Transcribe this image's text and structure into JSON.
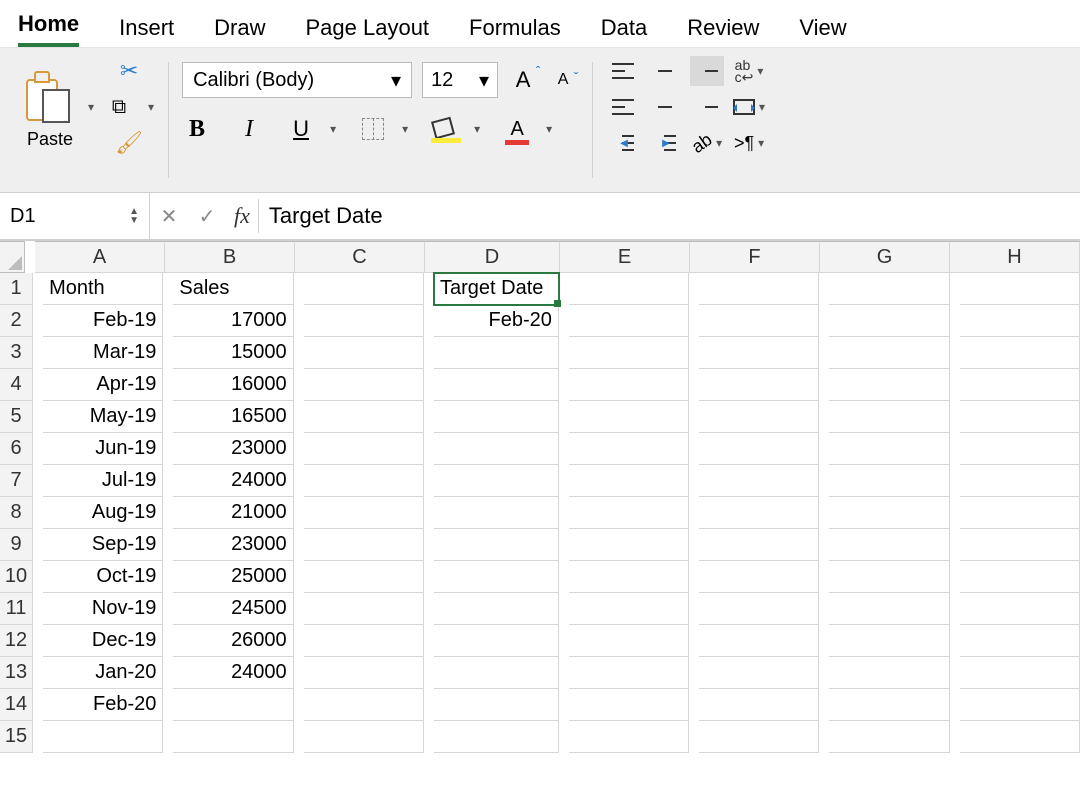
{
  "tabs": [
    "Home",
    "Insert",
    "Draw",
    "Page Layout",
    "Formulas",
    "Data",
    "Review",
    "View"
  ],
  "active_tab": "Home",
  "clipboard": {
    "paste_label": "Paste"
  },
  "font": {
    "name": "Calibri (Body)",
    "size": "12",
    "bold": "B",
    "italic": "I",
    "underline": "U",
    "grow": "A",
    "shrink": "A",
    "fontcolor_letter": "A"
  },
  "alignment": {
    "wrap_label": "ab\nc↩",
    "rotate_label": "ab",
    "para_label": ">¶"
  },
  "formula_bar": {
    "name_box": "D1",
    "fx": "fx",
    "value": "Target Date"
  },
  "columns": [
    "A",
    "B",
    "C",
    "D",
    "E",
    "F",
    "G",
    "H"
  ],
  "row_count": 15,
  "selected_cell": "D1",
  "cells": {
    "A1": {
      "v": "Month",
      "align": "txt"
    },
    "B1": {
      "v": "Sales",
      "align": "txt"
    },
    "D1": {
      "v": "Target Date",
      "align": "txt"
    },
    "A2": {
      "v": "Feb-19",
      "align": "num"
    },
    "B2": {
      "v": "17000",
      "align": "num"
    },
    "D2": {
      "v": "Feb-20",
      "align": "num"
    },
    "A3": {
      "v": "Mar-19",
      "align": "num"
    },
    "B3": {
      "v": "15000",
      "align": "num"
    },
    "A4": {
      "v": "Apr-19",
      "align": "num"
    },
    "B4": {
      "v": "16000",
      "align": "num"
    },
    "A5": {
      "v": "May-19",
      "align": "num"
    },
    "B5": {
      "v": "16500",
      "align": "num"
    },
    "A6": {
      "v": "Jun-19",
      "align": "num"
    },
    "B6": {
      "v": "23000",
      "align": "num"
    },
    "A7": {
      "v": "Jul-19",
      "align": "num"
    },
    "B7": {
      "v": "24000",
      "align": "num"
    },
    "A8": {
      "v": "Aug-19",
      "align": "num"
    },
    "B8": {
      "v": "21000",
      "align": "num"
    },
    "A9": {
      "v": "Sep-19",
      "align": "num"
    },
    "B9": {
      "v": "23000",
      "align": "num"
    },
    "A10": {
      "v": "Oct-19",
      "align": "num"
    },
    "B10": {
      "v": "25000",
      "align": "num"
    },
    "A11": {
      "v": "Nov-19",
      "align": "num"
    },
    "B11": {
      "v": "24500",
      "align": "num"
    },
    "A12": {
      "v": "Dec-19",
      "align": "num"
    },
    "B12": {
      "v": "26000",
      "align": "num"
    },
    "A13": {
      "v": "Jan-20",
      "align": "num"
    },
    "B13": {
      "v": "24000",
      "align": "num"
    },
    "A14": {
      "v": "Feb-20",
      "align": "num"
    }
  },
  "chart_data": {
    "type": "table",
    "title": "",
    "columns": [
      "Month",
      "Sales"
    ],
    "rows": [
      [
        "Feb-19",
        17000
      ],
      [
        "Mar-19",
        15000
      ],
      [
        "Apr-19",
        16000
      ],
      [
        "May-19",
        16500
      ],
      [
        "Jun-19",
        23000
      ],
      [
        "Jul-19",
        24000
      ],
      [
        "Aug-19",
        21000
      ],
      [
        "Sep-19",
        23000
      ],
      [
        "Oct-19",
        25000
      ],
      [
        "Nov-19",
        24500
      ],
      [
        "Dec-19",
        26000
      ],
      [
        "Jan-20",
        24000
      ],
      [
        "Feb-20",
        null
      ]
    ],
    "aux": {
      "Target Date": "Feb-20"
    }
  }
}
